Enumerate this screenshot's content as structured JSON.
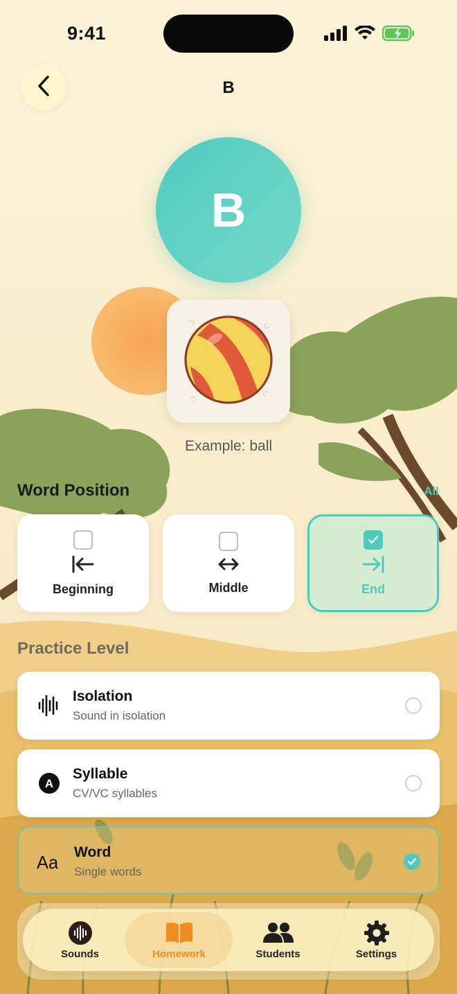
{
  "status": {
    "time": "9:41"
  },
  "header": {
    "title": "B"
  },
  "letter": "B",
  "example": {
    "label": "Example: ball"
  },
  "word_position": {
    "title": "Word Position",
    "all_label": "All",
    "options": [
      {
        "label": "Beginning",
        "checked": false
      },
      {
        "label": "Middle",
        "checked": false
      },
      {
        "label": "End",
        "checked": true
      }
    ]
  },
  "practice_level": {
    "title": "Practice Level",
    "levels": [
      {
        "title": "Isolation",
        "subtitle": "Sound in isolation",
        "icon": "waveform-icon",
        "selected": false
      },
      {
        "title": "Syllable",
        "subtitle": "CV/VC syllables",
        "icon": "letter-a-icon",
        "selected": false
      },
      {
        "title": "Word",
        "subtitle": "Single words",
        "icon": "text-aa-icon",
        "selected": true
      }
    ]
  },
  "tabbar": {
    "tabs": [
      {
        "label": "Sounds",
        "icon": "waveform-circle-icon"
      },
      {
        "label": "Homework",
        "icon": "book-icon",
        "active": true
      },
      {
        "label": "Students",
        "icon": "people-icon"
      },
      {
        "label": "Settings",
        "icon": "gear-icon"
      }
    ]
  },
  "colors": {
    "accent": "#4fc9bd",
    "tab_active": "#f08c1e",
    "background": "#f8ecd0"
  }
}
